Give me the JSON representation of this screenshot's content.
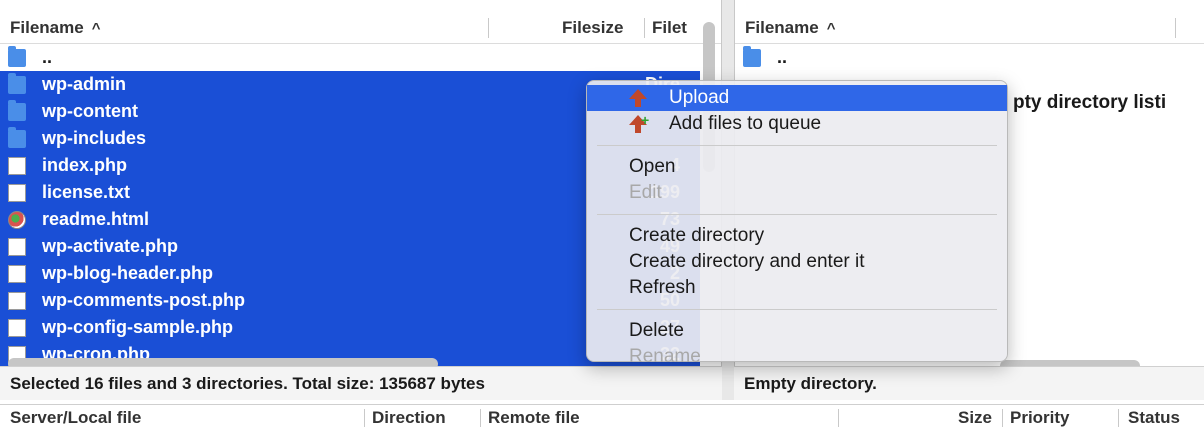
{
  "local": {
    "headers": {
      "filename": "Filename",
      "filesize": "Filesize",
      "filetype": "Filet"
    },
    "rows": [
      {
        "name": "..",
        "size": "",
        "icon": "folder-icon",
        "selected": false
      },
      {
        "name": "wp-admin",
        "size": "Dire",
        "icon": "folder-icon",
        "selected": true
      },
      {
        "name": "wp-content",
        "size": "",
        "icon": "folder-icon",
        "selected": true
      },
      {
        "name": "wp-includes",
        "size": "",
        "icon": "folder-icon",
        "selected": true
      },
      {
        "name": "index.php",
        "size": "4",
        "icon": "file-icon",
        "selected": true
      },
      {
        "name": "license.txt",
        "size": "199",
        "icon": "file-icon",
        "selected": true
      },
      {
        "name": "readme.html",
        "size": "73",
        "icon": "html-file-icon",
        "selected": true
      },
      {
        "name": "wp-activate.php",
        "size": "49",
        "icon": "file-icon",
        "selected": true
      },
      {
        "name": "wp-blog-header.php",
        "size": "2",
        "icon": "file-icon",
        "selected": true
      },
      {
        "name": "wp-comments-post.php",
        "size": "50",
        "icon": "file-icon",
        "selected": true
      },
      {
        "name": "wp-config-sample.php",
        "size": "27",
        "icon": "file-icon",
        "selected": true
      },
      {
        "name": "wp-cron.php",
        "size": "32",
        "icon": "file-icon",
        "selected": true
      }
    ],
    "status": "Selected 16 files and 3 directories. Total size: 135687 bytes"
  },
  "remote": {
    "headers": {
      "filename": "Filename"
    },
    "rows": [
      {
        "name": "..",
        "icon": "folder-icon"
      }
    ],
    "empty_listing": "pty directory listi",
    "status": "Empty directory."
  },
  "context_menu": {
    "items": [
      {
        "label": "Upload",
        "icon": "upload-arrow-icon",
        "highlighted": true,
        "disabled": false
      },
      {
        "label": "Add files to queue",
        "icon": "add-to-queue-icon",
        "highlighted": false,
        "disabled": false
      },
      {
        "label": "Open",
        "disabled": false
      },
      {
        "label": "Edit",
        "disabled": true
      },
      {
        "label": "Create directory",
        "disabled": false
      },
      {
        "label": "Create directory and enter it",
        "disabled": false
      },
      {
        "label": "Refresh",
        "disabled": false
      },
      {
        "label": "Delete",
        "disabled": false
      },
      {
        "label": "Rename",
        "disabled": true
      }
    ]
  },
  "queue": {
    "headers": {
      "server_local": "Server/Local file",
      "direction": "Direction",
      "remote": "Remote file",
      "size": "Size",
      "priority": "Priority",
      "status": "Status"
    }
  },
  "colors": {
    "selection": "#1a4fd6",
    "menu_highlight": "#2f67e8",
    "folder": "#4a8ee8",
    "upload_arrow": "#c0482b"
  }
}
